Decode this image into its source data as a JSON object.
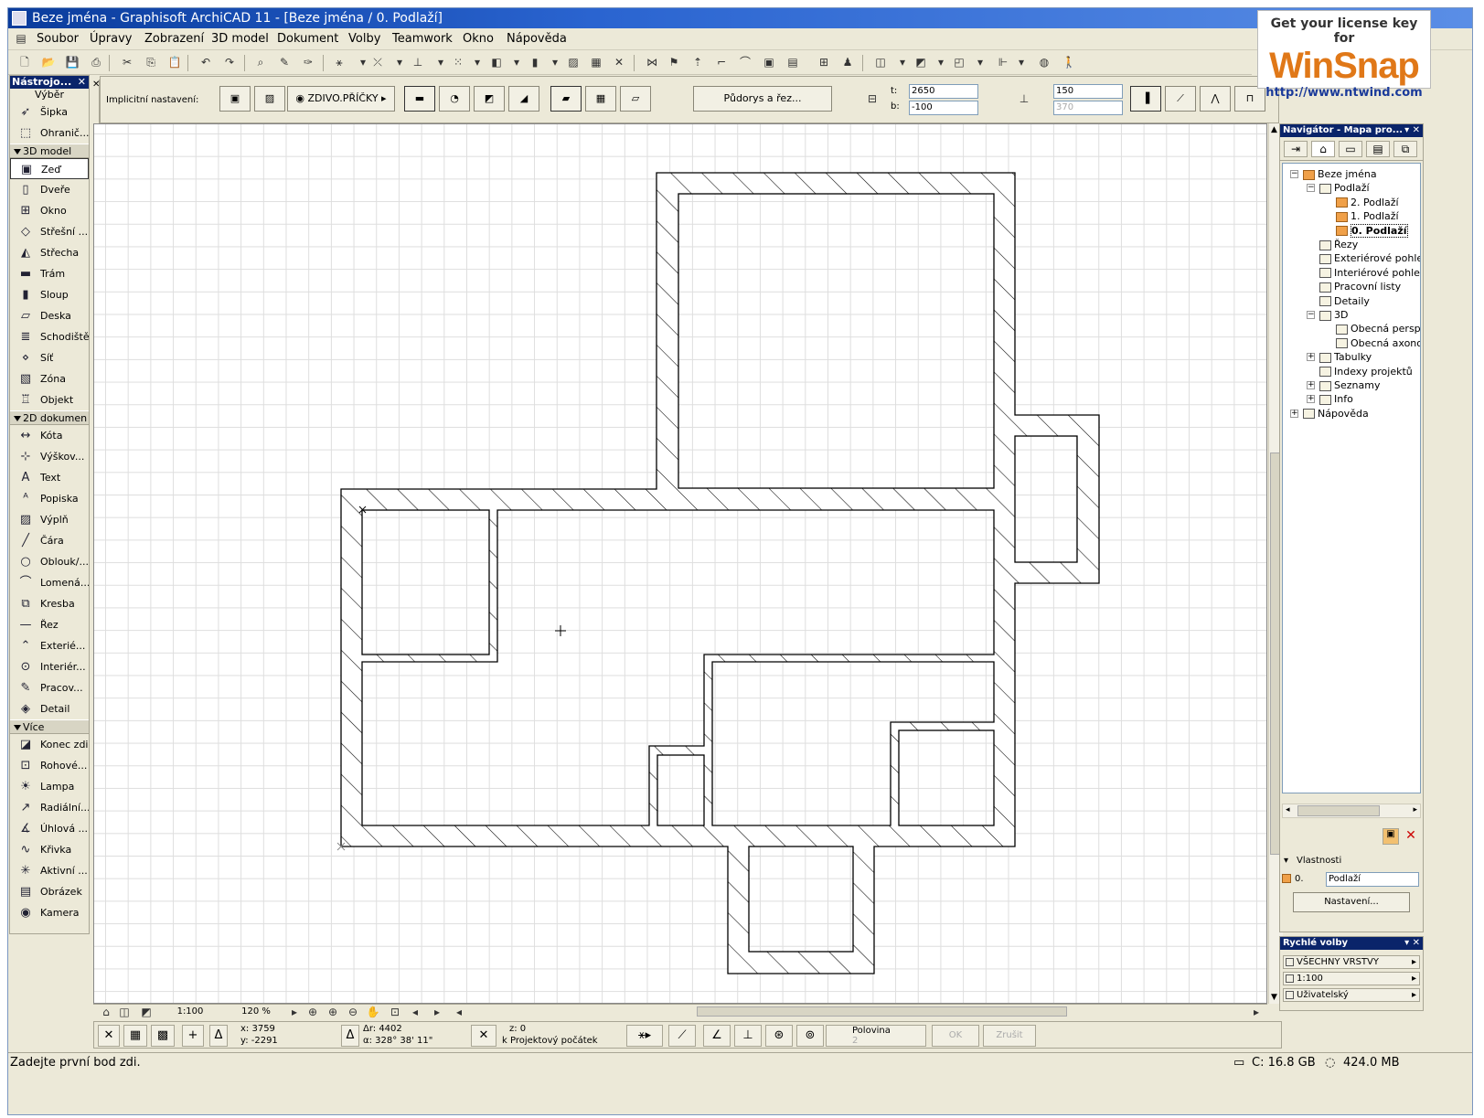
{
  "window": {
    "title": "Beze jména - Graphisoft ArchiCAD 11 - [Beze jména / 0. Podlaží]"
  },
  "watermark": {
    "line1": "Get your license key for",
    "logo": "WinSnap",
    "url": "http://www.ntwind.com"
  },
  "menu": [
    "Soubor",
    "Úpravy",
    "Zobrazení",
    "3D model",
    "Dokument",
    "Volby",
    "Teamwork",
    "Okno",
    "Nápověda"
  ],
  "infobox": {
    "label": "Implicitní nastavení:",
    "composite": "ZDIVO.PŘÍČKY",
    "floorplan_btn": "Půdorys a řez...",
    "t_label": "t:",
    "b_label": "b:",
    "t_value": "2650",
    "b_value": "-100",
    "thickness1": "150",
    "thickness2": "370"
  },
  "toolbox": {
    "title": "Nástrojo...",
    "select_label": "Výběr",
    "tools_select": [
      {
        "label": "Šipka",
        "icon": "arrow-pointer-icon"
      },
      {
        "label": "Ohranič...",
        "icon": "marquee-icon"
      }
    ],
    "section_3d": "3D model",
    "tools_3d": [
      {
        "label": "Zeď",
        "icon": "wall-icon"
      },
      {
        "label": "Dveře",
        "icon": "door-icon"
      },
      {
        "label": "Okno",
        "icon": "window-icon"
      },
      {
        "label": "Střešní ...",
        "icon": "roof-window-icon"
      },
      {
        "label": "Střecha",
        "icon": "roof-icon"
      },
      {
        "label": "Trám",
        "icon": "beam-icon"
      },
      {
        "label": "Sloup",
        "icon": "column-icon"
      },
      {
        "label": "Deska",
        "icon": "slab-icon"
      },
      {
        "label": "Schodiště",
        "icon": "stairs-icon"
      },
      {
        "label": "Síť",
        "icon": "mesh-icon"
      },
      {
        "label": "Zóna",
        "icon": "zone-icon"
      },
      {
        "label": "Objekt",
        "icon": "object-icon"
      }
    ],
    "section_2d": "2D dokumen",
    "tools_2d": [
      {
        "label": "Kóta",
        "icon": "dimension-icon"
      },
      {
        "label": "Výškov...",
        "icon": "level-dimension-icon"
      },
      {
        "label": "Text",
        "icon": "text-icon"
      },
      {
        "label": "Popiska",
        "icon": "label-icon"
      },
      {
        "label": "Výplň",
        "icon": "fill-icon"
      },
      {
        "label": "Čára",
        "icon": "line-icon"
      },
      {
        "label": "Oblouk/...",
        "icon": "arc-icon"
      },
      {
        "label": "Lomená...",
        "icon": "polyline-icon"
      },
      {
        "label": "Kresba",
        "icon": "drawing-icon"
      },
      {
        "label": "Řez",
        "icon": "section-icon"
      },
      {
        "label": "Exterié...",
        "icon": "elevation-icon"
      },
      {
        "label": "Interiér...",
        "icon": "interior-elevation-icon"
      },
      {
        "label": "Pracov...",
        "icon": "worksheet-icon"
      },
      {
        "label": "Detail",
        "icon": "detail-icon"
      }
    ],
    "section_more": "Více",
    "tools_more": [
      {
        "label": "Konec zdi",
        "icon": "wall-end-icon"
      },
      {
        "label": "Rohové...",
        "icon": "corner-window-icon"
      },
      {
        "label": "Lampa",
        "icon": "lamp-icon"
      },
      {
        "label": "Radiální...",
        "icon": "radial-dimension-icon"
      },
      {
        "label": "Úhlová ...",
        "icon": "angle-dimension-icon"
      },
      {
        "label": "Křivka",
        "icon": "spline-icon"
      },
      {
        "label": "Aktivní ...",
        "icon": "hotspot-icon"
      },
      {
        "label": "Obrázek",
        "icon": "image-icon"
      },
      {
        "label": "Kamera",
        "icon": "camera-icon"
      }
    ]
  },
  "navigator": {
    "title": "Navigátor - Mapa pro...",
    "tree": [
      {
        "label": "Beze jména",
        "level": 0,
        "exp": "−",
        "icon": "house"
      },
      {
        "label": "Podlaží",
        "level": 1,
        "exp": "−",
        "icon": "doc"
      },
      {
        "label": "2. Podlaží",
        "level": 2,
        "exp": "",
        "icon": "fold"
      },
      {
        "label": "1. Podlaží",
        "level": 2,
        "exp": "",
        "icon": "fold"
      },
      {
        "label": "0. Podlaží",
        "level": 2,
        "exp": "",
        "icon": "fold",
        "current": true
      },
      {
        "label": "Řezy",
        "level": 1,
        "exp": "",
        "icon": "doc"
      },
      {
        "label": "Exteriérové pohledy",
        "level": 1,
        "exp": "",
        "icon": "doc"
      },
      {
        "label": "Interiérové pohledy",
        "level": 1,
        "exp": "",
        "icon": "doc"
      },
      {
        "label": "Pracovní listy",
        "level": 1,
        "exp": "",
        "icon": "doc"
      },
      {
        "label": "Detaily",
        "level": 1,
        "exp": "",
        "icon": "doc"
      },
      {
        "label": "3D",
        "level": 1,
        "exp": "−",
        "icon": "doc"
      },
      {
        "label": "Obecná perspek",
        "level": 2,
        "exp": "",
        "icon": "cam"
      },
      {
        "label": "Obecná axonom",
        "level": 2,
        "exp": "",
        "icon": "box"
      },
      {
        "label": "Tabulky",
        "level": 1,
        "exp": "+",
        "icon": "doc"
      },
      {
        "label": "Indexy projektů",
        "level": 1,
        "exp": "",
        "icon": "doc"
      },
      {
        "label": "Seznamy",
        "level": 1,
        "exp": "+",
        "icon": "doc"
      },
      {
        "label": "Info",
        "level": 1,
        "exp": "+",
        "icon": "doc"
      },
      {
        "label": "Nápověda",
        "level": 0,
        "exp": "+",
        "icon": "doc"
      }
    ],
    "props_title": "Vlastnosti",
    "props_id": "0.",
    "props_name": "Podlaží",
    "props_btn": "Nastavení..."
  },
  "quick": {
    "title": "Rychlé volby",
    "rows": [
      "VŠECHNY VRSTVY",
      "1:100",
      "Uživatelský"
    ]
  },
  "viewbar": {
    "scale": "1:100",
    "zoom": "120 %"
  },
  "coords": {
    "x": "x: 3759",
    "y": "y: -2291",
    "dr": "Δr: 4402",
    "angle": "α: 328° 38' 11\"",
    "z": "z: 0",
    "origin": "k Projektový počátek",
    "gravity": "Polovina",
    "gravity2": "2",
    "ok": "OK",
    "cancel": "Zrušit"
  },
  "status": {
    "message": "Zadejte první bod zdi.",
    "disk": "C: 16.8 GB",
    "mem": "424.0 MB"
  },
  "colors": {
    "titlebar": "#0a3c9c",
    "winsnap_orange": "#e07818",
    "panel_bg": "#ece9d8"
  }
}
